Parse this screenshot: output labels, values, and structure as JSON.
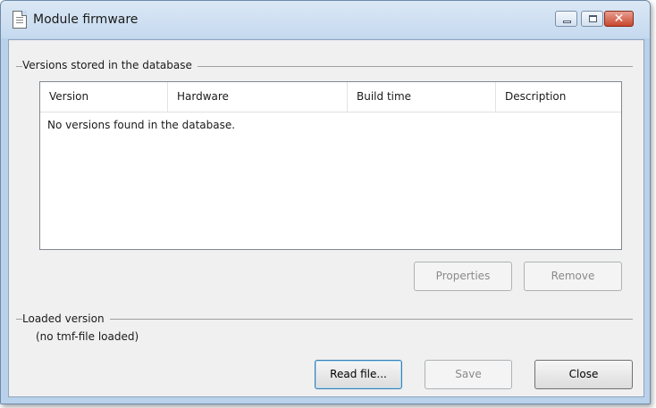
{
  "window": {
    "title": "Module firmware",
    "controls": {
      "minimize": "minimize",
      "maximize": "maximize",
      "close_glyph": "✕"
    }
  },
  "versions_group": {
    "label": "Versions stored in the database",
    "columns": [
      "Version",
      "Hardware",
      "Build time",
      "Description"
    ],
    "empty_message": "No versions found in the database.",
    "buttons": {
      "properties": "Properties",
      "remove": "Remove"
    }
  },
  "loaded_group": {
    "label": "Loaded version",
    "status": "(no tmf-file loaded)"
  },
  "footer_buttons": {
    "read_file": "Read file...",
    "save": "Save",
    "close": "Close"
  }
}
